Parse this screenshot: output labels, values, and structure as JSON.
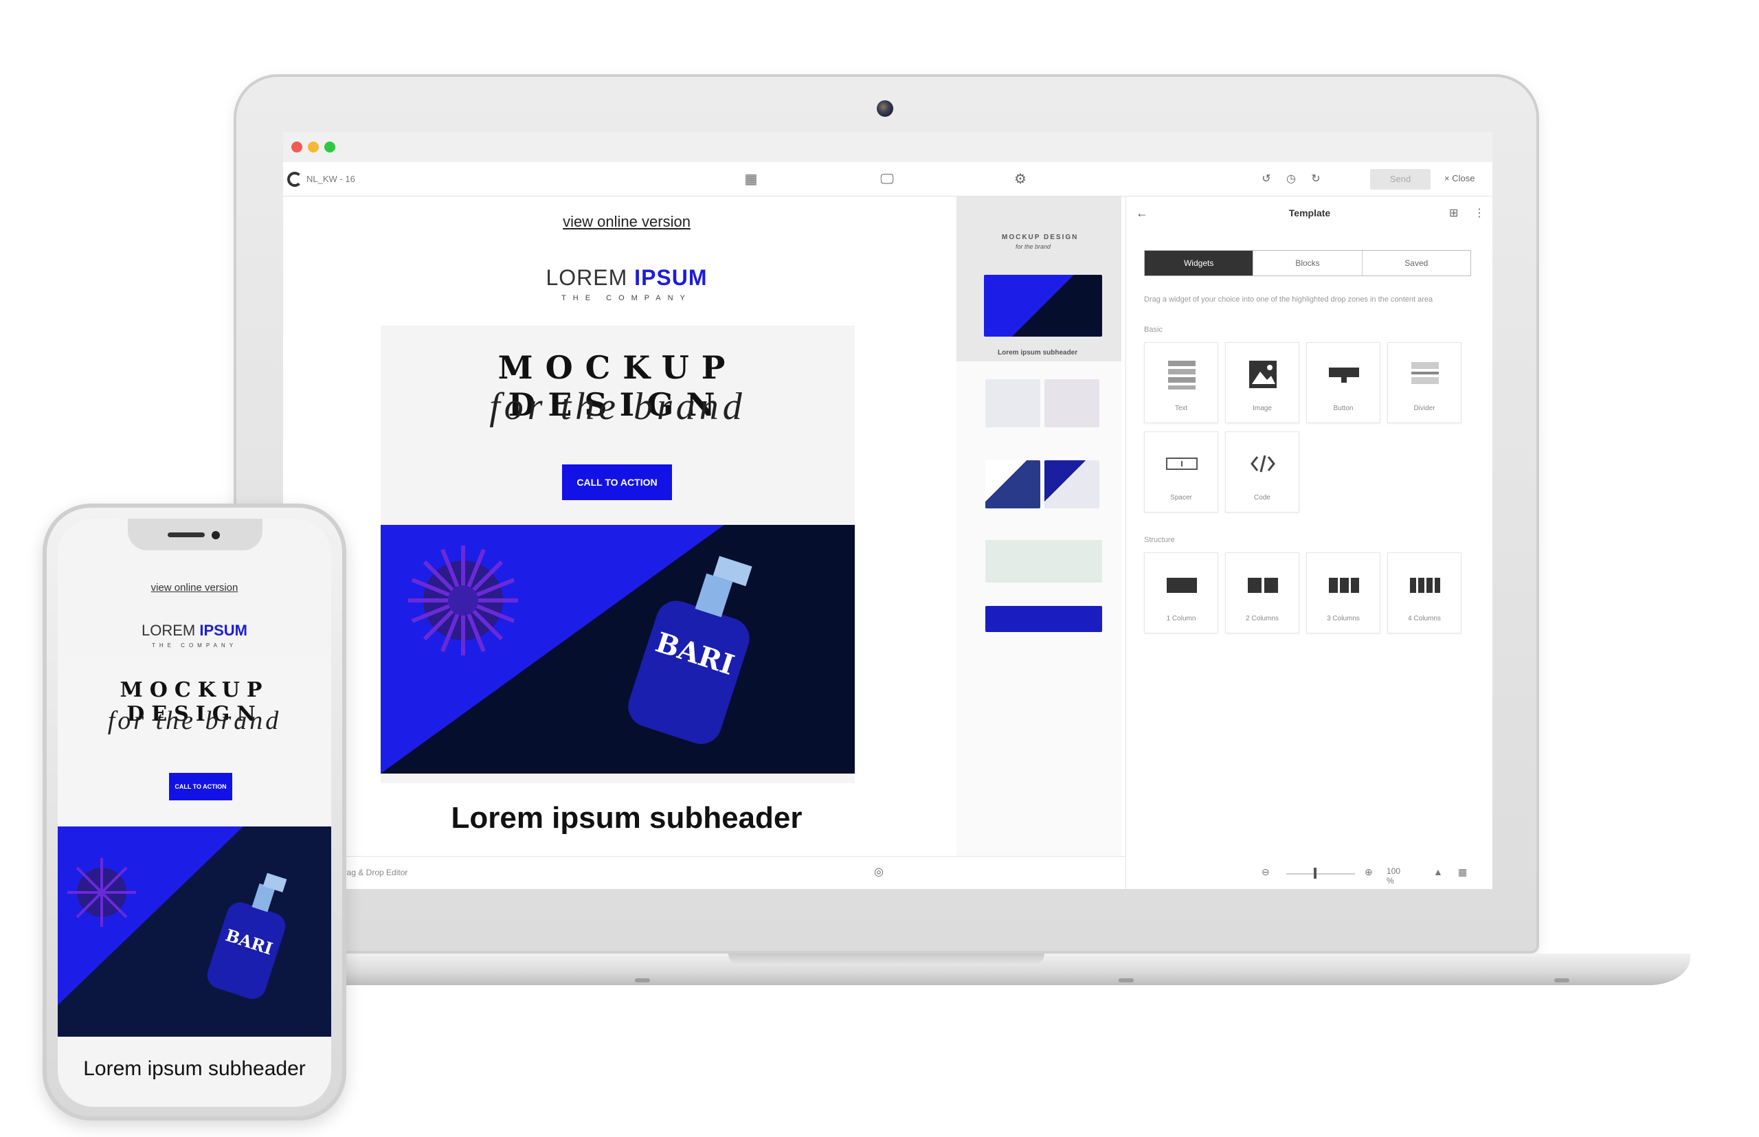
{
  "app": {
    "document_name": "NL_KW - 16",
    "send_label": "Send",
    "close_label": "× Close"
  },
  "email": {
    "view_online": "view online version",
    "logo_part1": "LOREM ",
    "logo_part2": "IPSUM",
    "logo_sub": "THE COMPANY",
    "hero_title": "MOCKUP DESIGN",
    "hero_script": "for the brand",
    "cta": "CALL TO ACTION",
    "product_text": "BARI",
    "subheader": "Lorem ipsum subheader"
  },
  "minimap": {
    "subheader": "Lorem ipsum subheader"
  },
  "panel": {
    "title": "Template",
    "tabs": [
      "Widgets",
      "Blocks",
      "Saved"
    ],
    "hint": "Drag a widget of your choice into one of the highlighted drop zones in the content area",
    "basic_label": "Basic",
    "widgets": [
      "Text",
      "Image",
      "Button",
      "Divider",
      "Spacer",
      "Code"
    ],
    "structure_label": "Structure",
    "structures": [
      "1 Column",
      "2 Columns",
      "3 Columns",
      "4 Columns"
    ]
  },
  "bottombar": {
    "editor": "Drag & Drop Editor",
    "zoom": "100 %"
  },
  "colors": {
    "brand_blue": "#1c1cdc",
    "cta_blue": "#1212e6",
    "dark_navy": "#060e2e"
  }
}
